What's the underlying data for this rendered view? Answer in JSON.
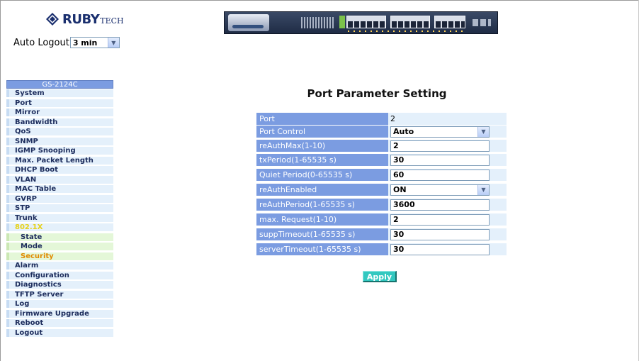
{
  "brand": {
    "logo_text": "RUBY",
    "logo_sub": "TECH"
  },
  "auto_logout": {
    "label": "Auto Logout",
    "selected": "3 min"
  },
  "sidebar": {
    "title": "GS-2124C",
    "items": [
      {
        "label": "System"
      },
      {
        "label": "Port"
      },
      {
        "label": "Mirror"
      },
      {
        "label": "Bandwidth"
      },
      {
        "label": "QoS"
      },
      {
        "label": "SNMP"
      },
      {
        "label": "IGMP Snooping"
      },
      {
        "label": "Max. Packet Length"
      },
      {
        "label": "DHCP Boot"
      },
      {
        "label": "VLAN"
      },
      {
        "label": "MAC Table"
      },
      {
        "label": "GVRP"
      },
      {
        "label": "STP"
      },
      {
        "label": "Trunk"
      },
      {
        "label": "802.1X"
      },
      {
        "label": "State"
      },
      {
        "label": "Mode"
      },
      {
        "label": "Security"
      },
      {
        "label": "Alarm"
      },
      {
        "label": "Configuration"
      },
      {
        "label": "Diagnostics"
      },
      {
        "label": "TFTP Server"
      },
      {
        "label": "Log"
      },
      {
        "label": "Firmware Upgrade"
      },
      {
        "label": "Reboot"
      },
      {
        "label": "Logout"
      }
    ]
  },
  "main": {
    "title": "Port Parameter Setting",
    "rows": [
      {
        "label": "Port",
        "value": "2"
      },
      {
        "label": "Port Control",
        "value": "Auto"
      },
      {
        "label": "reAuthMax(1-10)",
        "value": "2"
      },
      {
        "label": "txPeriod(1-65535 s)",
        "value": "30"
      },
      {
        "label": "Quiet Period(0-65535 s)",
        "value": "60"
      },
      {
        "label": "reAuthEnabled",
        "value": "ON"
      },
      {
        "label": "reAuthPeriod(1-65535 s)",
        "value": "3600"
      },
      {
        "label": "max. Request(1-10)",
        "value": "2"
      },
      {
        "label": "suppTimeout(1-65535 s)",
        "value": "30"
      },
      {
        "label": "serverTimeout(1-65535 s)",
        "value": "30"
      }
    ],
    "apply_label": "Apply"
  },
  "colors": {
    "menu_header": "#7b9ce1",
    "menu_item_bg": "#e4f0fb",
    "submenu_bg": "#e4f7d8",
    "active_item": "#e08a00",
    "open_parent": "#e6d21a",
    "apply_button": "#33c8c0"
  }
}
